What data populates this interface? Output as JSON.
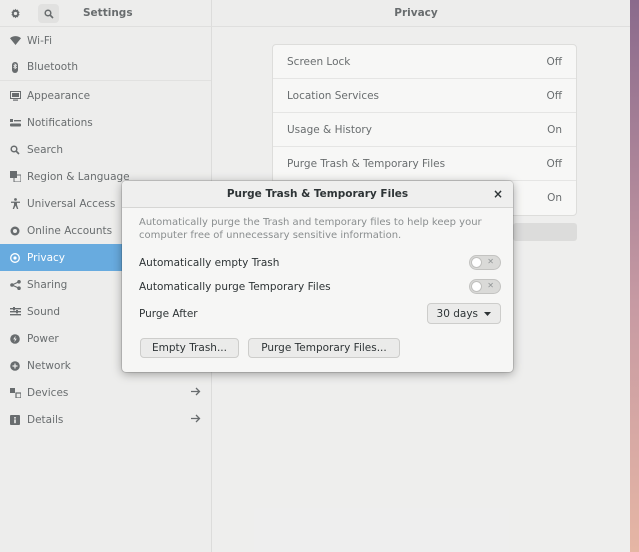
{
  "titlebar": {
    "app_title": "Settings",
    "page_title": "Privacy",
    "controls": {
      "minimize": "–",
      "restore": "⤢",
      "close": "×"
    },
    "icons": [
      "gear-icon",
      "search-icon"
    ]
  },
  "sidebar": {
    "items": [
      {
        "label": "Wi-Fi",
        "icon": "wifi-icon"
      },
      {
        "label": "Bluetooth",
        "icon": "bluetooth-icon"
      },
      {
        "label": "Appearance",
        "icon": "appearance-icon"
      },
      {
        "label": "Notifications",
        "icon": "notifications-icon"
      },
      {
        "label": "Search",
        "icon": "search-icon"
      },
      {
        "label": "Region & Language",
        "icon": "region-icon"
      },
      {
        "label": "Universal Access",
        "icon": "accessibility-icon"
      },
      {
        "label": "Online Accounts",
        "icon": "online-accounts-icon"
      },
      {
        "label": "Privacy",
        "icon": "privacy-icon"
      },
      {
        "label": "Sharing",
        "icon": "sharing-icon"
      },
      {
        "label": "Sound",
        "icon": "sound-icon"
      },
      {
        "label": "Power",
        "icon": "power-icon"
      },
      {
        "label": "Network",
        "icon": "network-icon"
      },
      {
        "label": "Devices",
        "icon": "devices-icon"
      },
      {
        "label": "Details",
        "icon": "details-icon"
      }
    ],
    "active": "Privacy"
  },
  "privacy_list": [
    {
      "label": "Screen Lock",
      "value": "Off"
    },
    {
      "label": "Location Services",
      "value": "Off"
    },
    {
      "label": "Usage & History",
      "value": "On"
    },
    {
      "label": "Purge Trash & Temporary Files",
      "value": "Off"
    },
    {
      "label": "",
      "value": "On"
    }
  ],
  "dialog": {
    "title": "Purge Trash & Temporary Files",
    "close": "×",
    "description": "Automatically purge the Trash and temporary files to help keep your computer free of unnecessary sensitive information.",
    "auto_empty_trash": {
      "label": "Automatically empty Trash",
      "on": false
    },
    "auto_purge_temp": {
      "label": "Automatically purge Temporary Files",
      "on": false
    },
    "purge_after": {
      "label": "Purge After",
      "value": "30 days"
    },
    "buttons": {
      "empty_trash": "Empty Trash...",
      "purge_temp": "Purge Temporary Files..."
    }
  },
  "colors": {
    "accent": "#2f8bd3"
  }
}
